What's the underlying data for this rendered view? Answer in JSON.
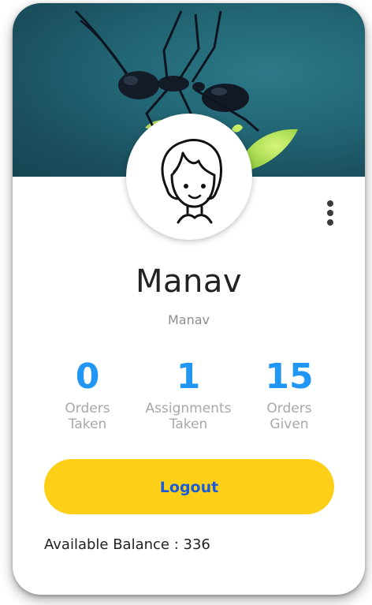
{
  "profile": {
    "display_name": "Manav",
    "username": "Manav"
  },
  "stats": [
    {
      "value": "0",
      "label_line1": "Orders",
      "label_line2": "Taken"
    },
    {
      "value": "1",
      "label_line1": "Assignments",
      "label_line2": "Taken"
    },
    {
      "value": "15",
      "label_line1": "Orders",
      "label_line2": "Given"
    }
  ],
  "actions": {
    "logout_label": "Logout"
  },
  "balance": {
    "text": "Available Balance : 336"
  },
  "icons": {
    "menu": "more-vertical-icon",
    "avatar": "cartoon-avatar"
  },
  "colors": {
    "accent_blue": "#2196f3",
    "button_yellow": "#fdd017",
    "button_text": "#1a5cd8",
    "cover_teal": "#226674"
  }
}
